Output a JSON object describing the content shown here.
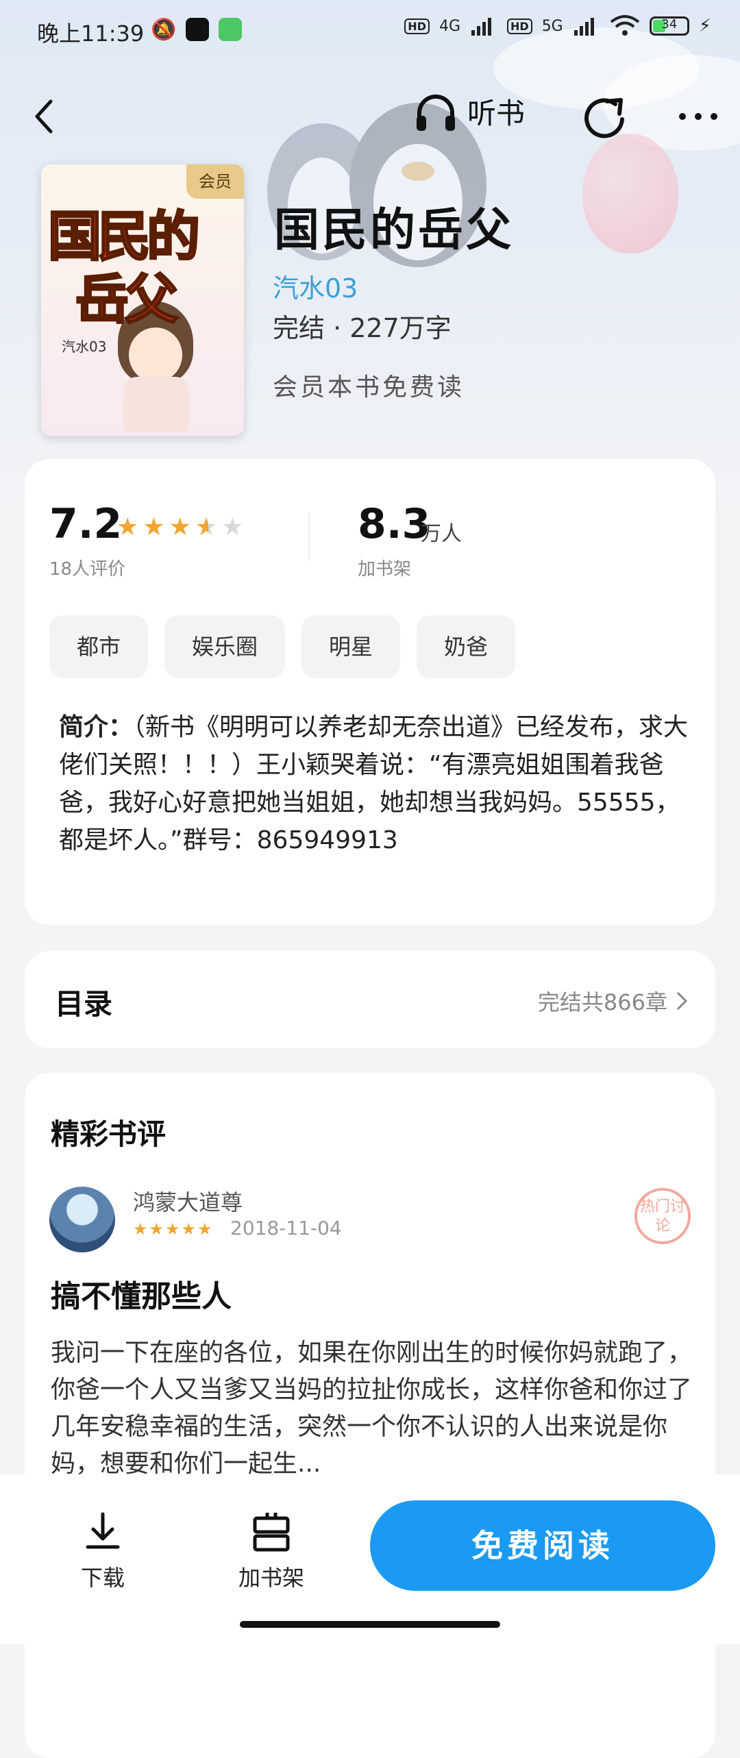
{
  "status_bar": {
    "time": "晚上11:39",
    "network_1": "4G",
    "network_2": "5G",
    "hd": "HD",
    "battery": "34"
  },
  "nav": {
    "listen_label": "听书"
  },
  "book": {
    "cover_badge": "会员",
    "cover_title_line1": "国民的",
    "cover_title_line2": "岳父",
    "cover_author_tag": "汽水03",
    "title": "国民的岳父",
    "author": "汽水03",
    "status_line": "完结 · 227万字",
    "vip_free": "会员本书免费读"
  },
  "stats": {
    "score": "7.2",
    "rating": 3.6,
    "rating_count": "18人评价",
    "shelf_num": "8.3",
    "shelf_unit": "万人",
    "shelf_label": "加书架"
  },
  "tags": [
    "都市",
    "娱乐圈",
    "明星",
    "奶爸"
  ],
  "intro": {
    "label": "简介：",
    "text": "（新书《明明可以养老却无奈出道》已经发布，求大佬们关照！！！）王小颖哭着说：“有漂亮姐姐围着我爸爸，我好心好意把她当姐姐，她却想当我妈妈。55555，都是坏人。”群号：865949913"
  },
  "toc": {
    "title": "目录",
    "summary": "完结共866章"
  },
  "reviews": {
    "header": "精彩书评",
    "user": "鸿蒙大道尊",
    "date": "2018-11-04",
    "badge": "热门讨论",
    "title": "搞不懂那些人",
    "body": "我问一下在座的各位，如果在你刚出生的时候你妈就跑了，你爸一个人又当爹又当妈的拉扯你成长，这样你爸和你过了几年安稳幸福的生活，突然一个你不认识的人出来说是你妈，想要和你们一起生..."
  },
  "bottom_bar": {
    "download_label": "下载",
    "shelf_label": "加书架",
    "read_label": "免费阅读"
  },
  "colors": {
    "accent": "#1a9af2",
    "author_link": "#3aa0d8",
    "star": "#f2a531",
    "vip": "#e8c98a"
  }
}
